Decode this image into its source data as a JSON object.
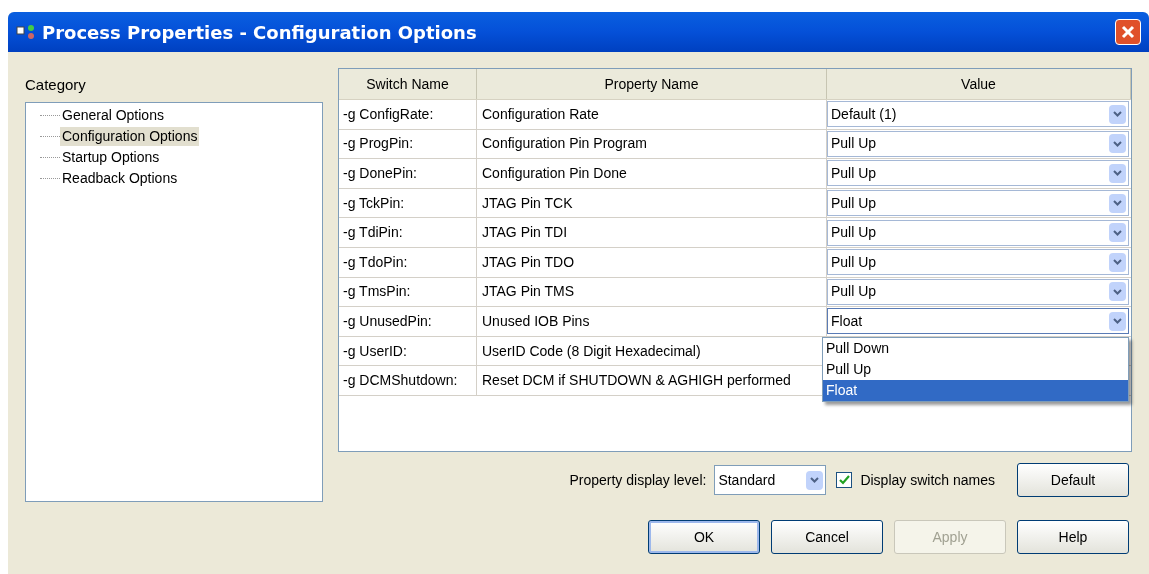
{
  "window": {
    "title": "Process Properties - Configuration Options"
  },
  "category": {
    "label": "Category",
    "items": [
      {
        "label": "General Options",
        "selected": false
      },
      {
        "label": "Configuration Options",
        "selected": true
      },
      {
        "label": "Startup Options",
        "selected": false
      },
      {
        "label": "Readback Options",
        "selected": false
      }
    ]
  },
  "table": {
    "columns": [
      "Switch Name",
      "Property Name",
      "Value"
    ],
    "rows": [
      {
        "switch": "-g ConfigRate:",
        "property": "Configuration Rate",
        "value": "Default (1)"
      },
      {
        "switch": "-g ProgPin:",
        "property": "Configuration Pin Program",
        "value": "Pull Up"
      },
      {
        "switch": "-g DonePin:",
        "property": "Configuration Pin Done",
        "value": "Pull Up"
      },
      {
        "switch": "-g TckPin:",
        "property": "JTAG Pin TCK",
        "value": "Pull Up"
      },
      {
        "switch": "-g TdiPin:",
        "property": "JTAG Pin TDI",
        "value": "Pull Up"
      },
      {
        "switch": "-g TdoPin:",
        "property": "JTAG Pin TDO",
        "value": "Pull Up"
      },
      {
        "switch": "-g TmsPin:",
        "property": "JTAG Pin TMS",
        "value": "Pull Up"
      },
      {
        "switch": "-g UnusedPin:",
        "property": "Unused IOB Pins",
        "value": "Float",
        "expanded": true,
        "options": [
          {
            "label": "Pull Down",
            "selected": false
          },
          {
            "label": "Pull Up",
            "selected": false
          },
          {
            "label": "Float",
            "selected": true
          }
        ]
      },
      {
        "switch": "-g UserID:",
        "property": "UserID Code (8 Digit Hexadecimal)"
      },
      {
        "switch": "-g DCMShutdown:",
        "property": "Reset DCM if SHUTDOWN & AGHIGH performed"
      }
    ]
  },
  "display_level": {
    "label": "Property display level:",
    "value": "Standard"
  },
  "display_switch_names": {
    "label": "Display switch names",
    "checked": true
  },
  "default_button": "Default",
  "buttons": [
    {
      "label": "OK",
      "disabled": false,
      "default": true
    },
    {
      "label": "Cancel",
      "disabled": false,
      "default": false
    },
    {
      "label": "Apply",
      "disabled": true,
      "default": false
    },
    {
      "label": "Help",
      "disabled": false,
      "default": false
    }
  ]
}
